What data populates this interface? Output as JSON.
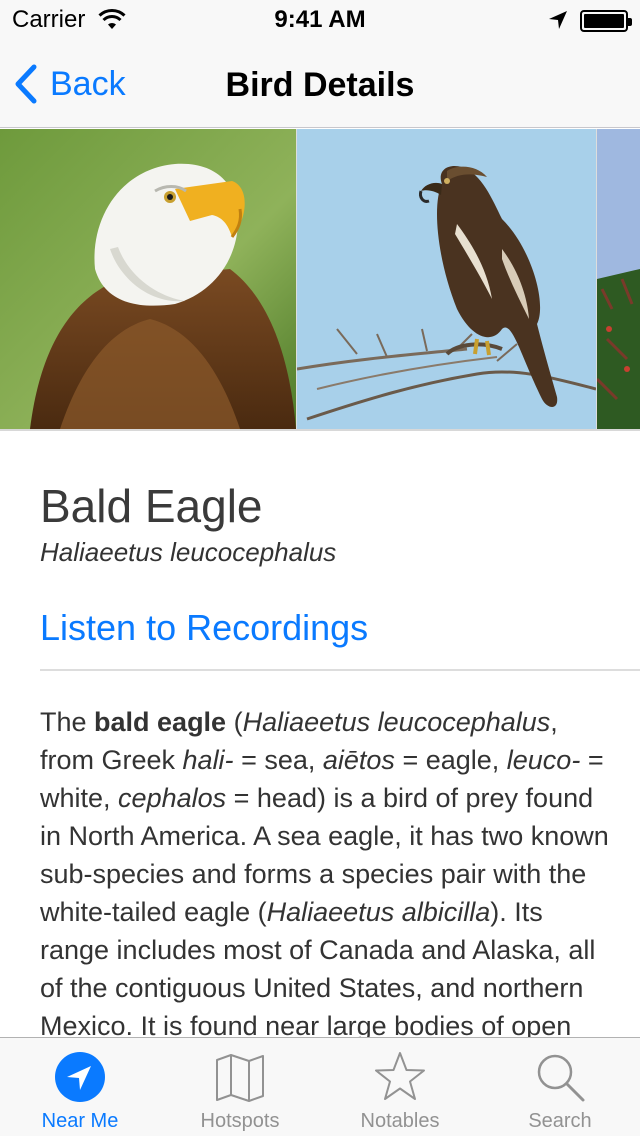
{
  "status_bar": {
    "carrier": "Carrier",
    "time": "9:41 AM"
  },
  "nav": {
    "back_label": "Back",
    "title": "Bird Details"
  },
  "gallery": {
    "photos": [
      "bald-eagle-adult-photo",
      "bald-eagle-juvenile-photo",
      "partial-photo"
    ]
  },
  "bird": {
    "common_name": "Bald Eagle",
    "scientific_name": "Haliaeetus leucocephalus",
    "listen_link": "Listen to Recordings",
    "description": {
      "p1": "The ",
      "b1": "bald eagle",
      "p2": " (",
      "i1": "Haliaeetus leucocephalus",
      "p3": ", from Greek ",
      "i2": "hali-",
      "p4": " = sea, ",
      "i3": "aiētos",
      "p5": " = eagle, ",
      "i4": "leuco-",
      "p6": " = white, ",
      "i5": "cephalos",
      "p7": " = head) is a bird of prey found in North America. A sea eagle, it has two known sub-species and forms a species pair with the white-tailed eagle (",
      "i6": "Haliaeetus albicilla",
      "p8": "). Its range includes most of Canada and Alaska, all of the contiguous United States, and northern Mexico. It is found near large bodies of open water"
    }
  },
  "tabs": [
    {
      "label": "Near Me",
      "icon": "location-arrow-icon",
      "active": true
    },
    {
      "label": "Hotspots",
      "icon": "map-icon",
      "active": false
    },
    {
      "label": "Notables",
      "icon": "star-icon",
      "active": false
    },
    {
      "label": "Search",
      "icon": "search-icon",
      "active": false
    }
  ],
  "colors": {
    "accent": "#0a7aff",
    "inactive_tab": "#929292",
    "bar_background": "#f8f8f8"
  }
}
